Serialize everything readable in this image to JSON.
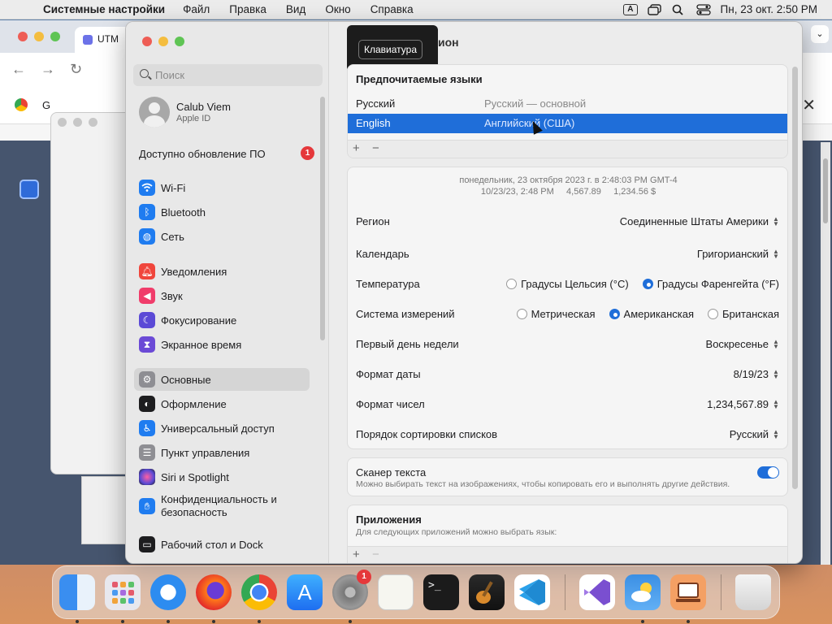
{
  "menubar": {
    "app_name": "Системные настройки",
    "menus": [
      "Файл",
      "Правка",
      "Вид",
      "Окно",
      "Справка"
    ],
    "input_indicator": "A",
    "clock": "Пн, 23 окт.  2:50 PM"
  },
  "chrome": {
    "tab_title": "UTM",
    "bookmark_fragment": "G"
  },
  "sidebar": {
    "search_placeholder": "Поиск",
    "user": {
      "name": "Calub Viem",
      "subtitle": "Apple ID"
    },
    "update": {
      "label": "Доступно обновление ПО",
      "badge": "1"
    },
    "items": [
      {
        "label": "Wi-Fi",
        "icon": "wifi-icon",
        "color": "#1f7cf0"
      },
      {
        "label": "Bluetooth",
        "icon": "bluetooth-icon",
        "color": "#1f7cf0"
      },
      {
        "label": "Сеть",
        "icon": "globe-icon",
        "color": "#1f7cf0"
      },
      {
        "label": "Уведомления",
        "icon": "bell-icon",
        "color": "#f0463c"
      },
      {
        "label": "Звук",
        "icon": "speaker-icon",
        "color": "#f03c6a"
      },
      {
        "label": "Фокусирование",
        "icon": "moon-icon",
        "color": "#5b4ad6"
      },
      {
        "label": "Экранное время",
        "icon": "hourglass-icon",
        "color": "#6b4ad6"
      },
      {
        "label": "Основные",
        "icon": "gear-icon",
        "color": "#8e8e93"
      },
      {
        "label": "Оформление",
        "icon": "appearance-icon",
        "color": "#1d1d1f"
      },
      {
        "label": "Универсальный доступ",
        "icon": "accessibility-icon",
        "color": "#1f7cf0"
      },
      {
        "label": "Пункт управления",
        "icon": "control-center-icon",
        "color": "#8e8e93"
      },
      {
        "label": "Siri и Spotlight",
        "icon": "siri-icon",
        "color": "#c13ad6"
      },
      {
        "label": "Конфиденциальность и безопасность",
        "icon": "hand-icon",
        "color": "#1f7cf0"
      },
      {
        "label": "Рабочий стол и Dock",
        "icon": "desktop-icon",
        "color": "#1d1d1f"
      }
    ]
  },
  "main": {
    "title_fragment": "ион",
    "tooltip": "Клавиатура",
    "preferred_languages": {
      "header": "Предпочитаемые языки",
      "rows": [
        {
          "name": "Русский",
          "detail": "Русский — основной"
        },
        {
          "name": "English",
          "detail": "Английский (США)"
        }
      ],
      "add": "+",
      "remove": "−"
    },
    "format_preview": {
      "line1": "понедельник, 23 октября 2023 г. в 2:48:03 PM GMT-4",
      "line2": "10/23/23, 2:48 PM     4,567.89     1,234.56 $"
    },
    "settings": {
      "region": {
        "label": "Регион",
        "value": "Соединенные Штаты Америки"
      },
      "calendar": {
        "label": "Календарь",
        "value": "Григорианский"
      },
      "temperature": {
        "label": "Температура",
        "options": [
          "Градусы Цельсия (°C)",
          "Градусы Фаренгейта (°F)"
        ],
        "selected": 1
      },
      "measurement": {
        "label": "Система измерений",
        "options": [
          "Метрическая",
          "Американская",
          "Британская"
        ],
        "selected": 1
      },
      "first_day": {
        "label": "Первый день недели",
        "value": "Воскресенье"
      },
      "date_format": {
        "label": "Формат даты",
        "value": "8/19/23"
      },
      "number_format": {
        "label": "Формат чисел",
        "value": "1,234,567.89"
      },
      "sort_order": {
        "label": "Порядок сортировки списков",
        "value": "Русский"
      }
    },
    "live_text": {
      "label": "Сканер текста",
      "description": "Можно выбирать текст на изображениях, чтобы копировать его и выполнять другие действия.",
      "enabled": true
    },
    "apps": {
      "header": "Приложения",
      "description": "Для следующих приложений можно выбрать язык:",
      "add": "+",
      "remove": "−"
    }
  },
  "dock": {
    "apps": [
      {
        "name": "Finder",
        "icon": "finder-icon"
      },
      {
        "name": "Launchpad",
        "icon": "launchpad-icon"
      },
      {
        "name": "Safari",
        "icon": "safari-icon"
      },
      {
        "name": "Firefox",
        "icon": "firefox-icon"
      },
      {
        "name": "Chrome",
        "icon": "chrome-icon"
      },
      {
        "name": "App Store",
        "icon": "appstore-icon"
      },
      {
        "name": "System Settings",
        "icon": "settings-icon",
        "badge": "1"
      },
      {
        "name": "TextEdit",
        "icon": "textedit-icon"
      },
      {
        "name": "Terminal",
        "icon": "terminal-icon"
      },
      {
        "name": "GarageBand",
        "icon": "guitar-icon"
      },
      {
        "name": "VS Code",
        "icon": "vscode-icon"
      },
      {
        "name": "Visual Studio",
        "icon": "visualstudio-icon"
      },
      {
        "name": "Weather",
        "icon": "weather-icon"
      },
      {
        "name": "UTM",
        "icon": "utm-icon"
      },
      {
        "name": "Trash",
        "icon": "trash-icon"
      }
    ]
  }
}
